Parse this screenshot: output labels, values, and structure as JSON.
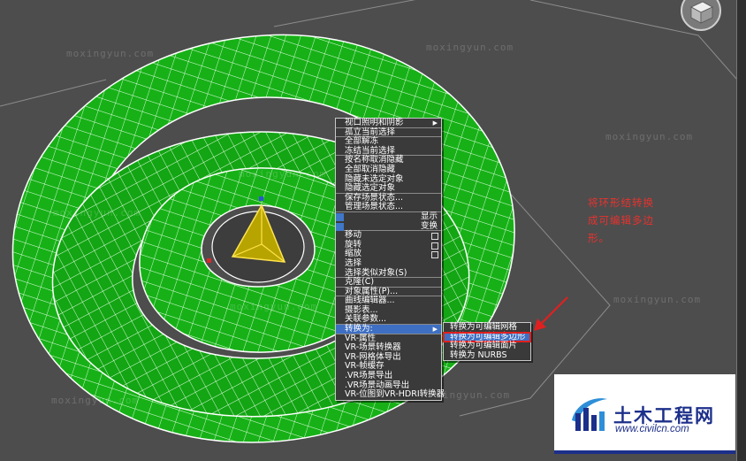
{
  "watermarks": [
    "moxingyun.com",
    "moxingyun.com",
    "moxingyun.com",
    "moxingyun.com",
    "moxingyun.com",
    "moxingyun.com",
    "moxingyun.com",
    "moxingyun.com",
    "moxingyun.com"
  ],
  "context_menu": {
    "items": [
      {
        "label": "视口照明和阴影",
        "arrow": "▶"
      },
      {
        "label": "孤立当前选择"
      },
      {
        "label": "全部解冻"
      },
      {
        "label": "冻结当前选择"
      },
      {
        "label": "按名称取消隐藏"
      },
      {
        "label": "全部取消隐藏"
      },
      {
        "label": "隐藏未选定对象"
      },
      {
        "label": "隐藏选定对象"
      },
      {
        "label": "保存场景状态..."
      },
      {
        "label": "管理场景状态..."
      },
      {
        "label": "显示"
      },
      {
        "label": "变换"
      },
      {
        "label": "移动"
      },
      {
        "label": "旋转"
      },
      {
        "label": "缩放"
      },
      {
        "label": "选择"
      },
      {
        "label": "选择类似对象(S)"
      },
      {
        "label": "克隆(C)"
      },
      {
        "label": "对象属性(P)..."
      },
      {
        "label": "曲线编辑器..."
      },
      {
        "label": "摄影表..."
      },
      {
        "label": "关联参数..."
      },
      {
        "label": "转换为:",
        "arrow": "▶"
      },
      {
        "label": "VR-属性"
      },
      {
        "label": "VR-场景转换器"
      },
      {
        "label": "VR-网格体导出"
      },
      {
        "label": "VR-帧缓存"
      },
      {
        "label": ".VR场景导出"
      },
      {
        "label": ".VR场景动画导出"
      },
      {
        "label": "VR-位图到VR-HDRI转换器"
      }
    ]
  },
  "submenu": {
    "items": [
      {
        "label": "转换为可编辑网格"
      },
      {
        "label": "转换为可编辑多边形"
      },
      {
        "label": "转换为可编辑面片"
      },
      {
        "label": "转换为 NURBS"
      }
    ]
  },
  "annotation": {
    "lines": [
      "将环形结转换",
      "成可编辑多边",
      "形。"
    ]
  },
  "logo": {
    "text": "土木工程网",
    "url": "www.civilcn.com"
  },
  "colors": {
    "viewport_bg": "#4d4d4d",
    "torus_green": "#17b117",
    "wire": "#ffffff",
    "menu_bg": "#3a3a3a",
    "highlight": "#3e6fc2",
    "annotation_red": "#e8322e",
    "logo_blue": "#1c2f8a"
  }
}
